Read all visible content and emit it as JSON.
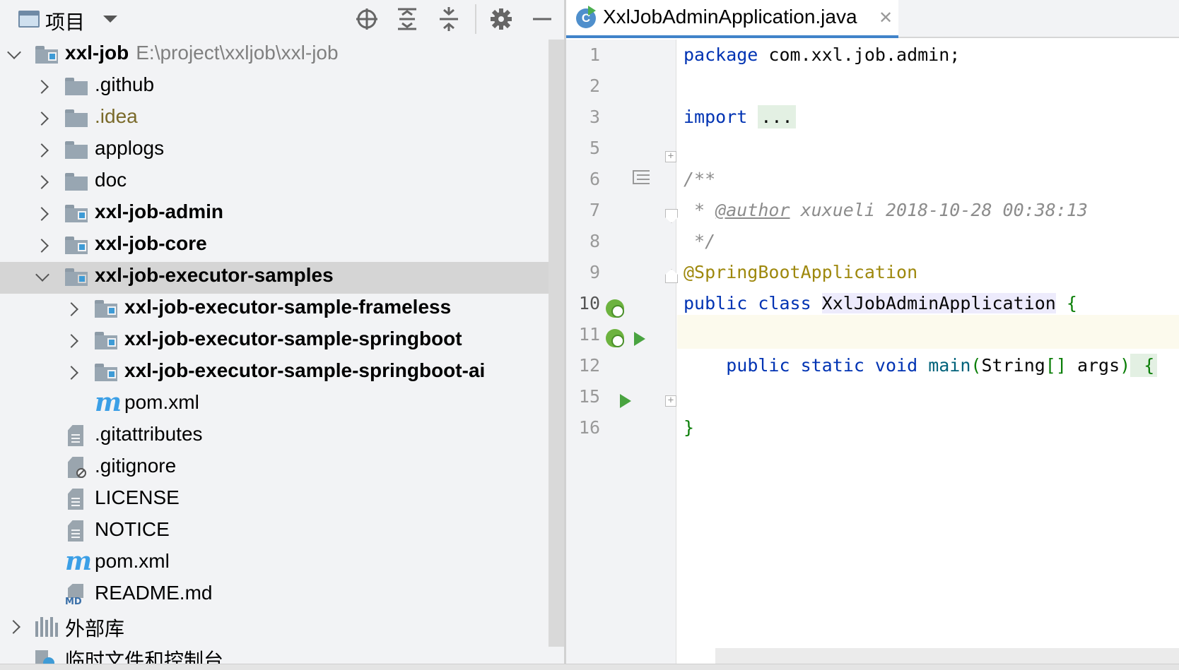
{
  "project_panel": {
    "title": "项目",
    "toolbar": {
      "locate_icon": "crosshair-icon",
      "expand_all_icon": "expand-all-icon",
      "collapse_all_icon": "collapse-all-icon",
      "settings_icon": "gear-icon",
      "hide_icon": "minimize-icon"
    },
    "tree": {
      "root": {
        "name": "xxl-job",
        "path": "E:\\project\\xxljob\\xxl-job"
      },
      "items": [
        {
          "name": ".github"
        },
        {
          "name": ".idea"
        },
        {
          "name": "applogs"
        },
        {
          "name": "doc"
        },
        {
          "name": "xxl-job-admin"
        },
        {
          "name": "xxl-job-core"
        },
        {
          "name": "xxl-job-executor-samples"
        },
        {
          "name": "xxl-job-executor-sample-frameless"
        },
        {
          "name": "xxl-job-executor-sample-springboot"
        },
        {
          "name": "xxl-job-executor-sample-springboot-ai"
        },
        {
          "name": "pom.xml"
        },
        {
          "name": ".gitattributes"
        },
        {
          "name": ".gitignore"
        },
        {
          "name": "LICENSE"
        },
        {
          "name": "NOTICE"
        },
        {
          "name": "pom.xml"
        },
        {
          "name": "README.md"
        },
        {
          "name": "外部库"
        },
        {
          "name": "临时文件和控制台"
        }
      ]
    }
  },
  "editor": {
    "tab": {
      "label": "XxlJobAdminApplication.java",
      "icon_text": "C"
    },
    "line_numbers": [
      "1",
      "2",
      "3",
      "5",
      "6",
      "7",
      "8",
      "9",
      "10",
      "11",
      "12",
      "15",
      "16"
    ],
    "code": {
      "l1_kw": "package",
      "l1_rest": " com.xxl.job.admin;",
      "l3_kw": "import",
      "l3_fold": "...",
      "l6": "/**",
      "l7_star": " * ",
      "l7_tag": "@author",
      "l7_rest": " xuxueli 2018-10-28 00:38:13",
      "l8": " */",
      "l9": "@SpringBootApplication",
      "l10_kw": "public class ",
      "l10_cls": "XxlJobAdminApplication",
      "l10_brace": " {",
      "l12_kw": "public static void ",
      "l12_method": "main",
      "l12_paren_open": "(",
      "l12_type": "String",
      "l12_arr": "[]",
      "l12_arg": " args",
      "l12_paren_close": ")",
      "l12_brace": " {",
      "l16": "}"
    }
  },
  "colors": {
    "keyword": "#0033b3",
    "annotation": "#9e880d",
    "comment": "#8c8c8c",
    "selection": "#d5d5d5",
    "module_badge": "#3e9bd6"
  }
}
